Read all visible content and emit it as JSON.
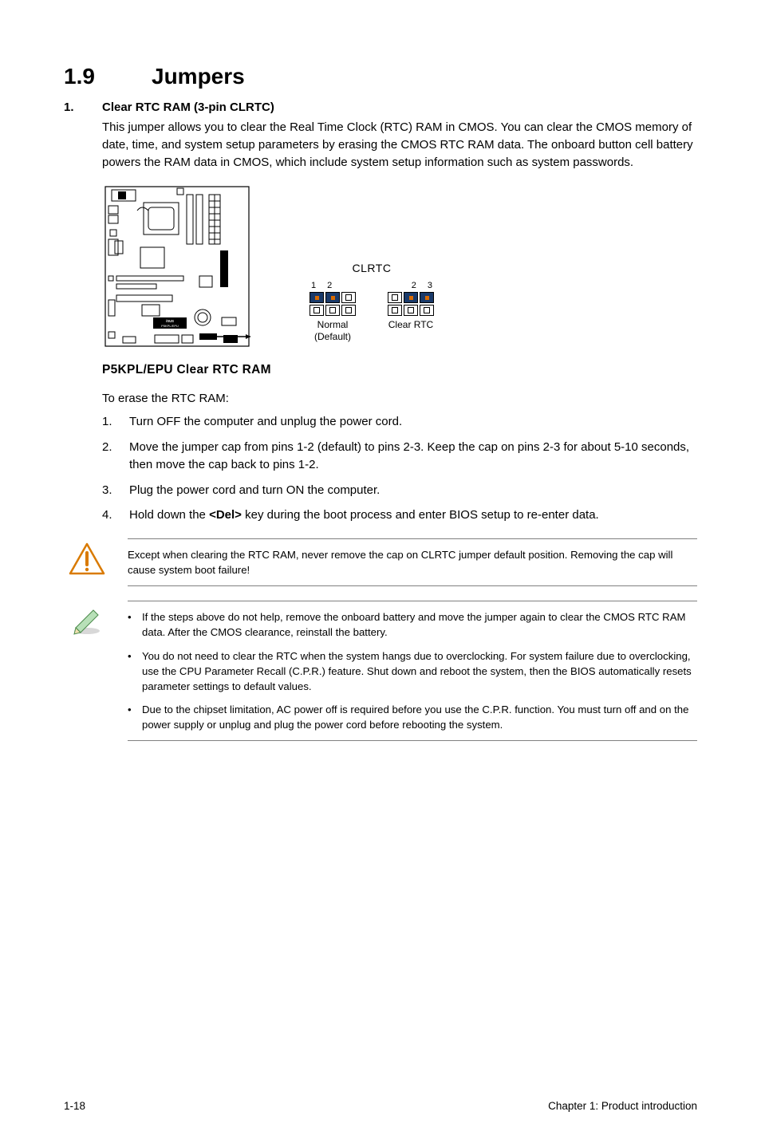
{
  "section": {
    "number": "1.9",
    "title": "Jumpers"
  },
  "item1": {
    "num": "1.",
    "title": "Clear RTC RAM (3-pin CLRTC)",
    "body": "This jumper allows you to clear the Real Time Clock (RTC) RAM in CMOS. You can clear the CMOS memory of date, time, and system setup parameters by erasing the CMOS RTC RAM data. The onboard button cell battery powers the RAM data in CMOS, which include system setup information such as system passwords."
  },
  "diagram": {
    "clrtc_title": "CLRTC",
    "normal_pins": {
      "p1": "1",
      "p2": "2"
    },
    "clear_pins": {
      "p2": "2",
      "p3": "3"
    },
    "normal_label": "Normal",
    "normal_sub": "(Default)",
    "clear_label": "Clear RTC",
    "caption": "P5KPL/EPU Clear RTC RAM",
    "board_label": "P5KPL/EPU"
  },
  "erase_intro": "To erase the RTC RAM:",
  "steps": [
    {
      "n": "1.",
      "t": "Turn OFF the computer and unplug the power cord."
    },
    {
      "n": "2.",
      "t": "Move the jumper cap from pins 1-2 (default) to pins 2-3. Keep the cap on pins 2-3 for about 5-10 seconds, then move the cap back to pins 1-2."
    },
    {
      "n": "3.",
      "t": "Plug the power cord and turn ON the computer."
    },
    {
      "n": "4.",
      "t_pre": "Hold down the ",
      "t_key": "<Del>",
      "t_post": " key during the boot process and enter BIOS setup to re-enter data."
    }
  ],
  "warning_note": "Except when clearing the RTC RAM, never remove the cap on CLRTC jumper default position. Removing the cap will cause system boot failure!",
  "info_notes": [
    "If the steps above do not help, remove the onboard battery and move the jumper again to clear the CMOS RTC RAM data. After the CMOS clearance, reinstall the battery.",
    "You do not need to clear the RTC when the system hangs due to overclocking. For system failure due to overclocking, use the CPU Parameter Recall (C.P.R.) feature. Shut down and reboot the system, then the BIOS automatically resets parameter settings to default values.",
    "Due to the chipset limitation, AC power off is required before you use the C.P.R. function. You must turn off and on the power supply or unplug and plug the power cord before rebooting the system."
  ],
  "footer": {
    "left": "1-18",
    "right": "Chapter 1: Product introduction"
  }
}
